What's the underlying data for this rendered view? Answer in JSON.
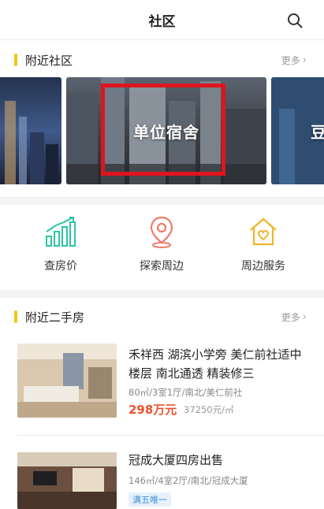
{
  "header": {
    "title": "社区",
    "search_icon": "search-icon"
  },
  "nearby_community": {
    "title": "附近社区",
    "more": "更多",
    "cards": [
      {
        "label": ""
      },
      {
        "label": "单位宿舍"
      },
      {
        "label": "豆"
      }
    ]
  },
  "quick_links": [
    {
      "label": "查房价",
      "icon": "bar-chart-trend-icon",
      "color": "#2cc5a3"
    },
    {
      "label": "探索周边",
      "icon": "map-pin-icon",
      "color": "#f07a6a"
    },
    {
      "label": "周边服务",
      "icon": "house-heart-icon",
      "color": "#f0b429"
    }
  ],
  "nearby_secondhand": {
    "title": "附近二手房",
    "more": "更多",
    "listings": [
      {
        "title": "禾祥西 湖滨小学旁 美仁前社适中楼层 南北通透 精装修三",
        "meta": "80㎡/3室1厅/南北/美仁前社",
        "price": "298万元",
        "unit_price": "37250元/㎡"
      },
      {
        "title": "冠成大厦四房出售",
        "meta": "146㎡/4室2厅/南北/冠成大厦",
        "tag": "满五唯一"
      }
    ]
  },
  "colors": {
    "accent_bar": "#f5c518",
    "price": "#e8532c",
    "highlight": "#e0141e"
  }
}
